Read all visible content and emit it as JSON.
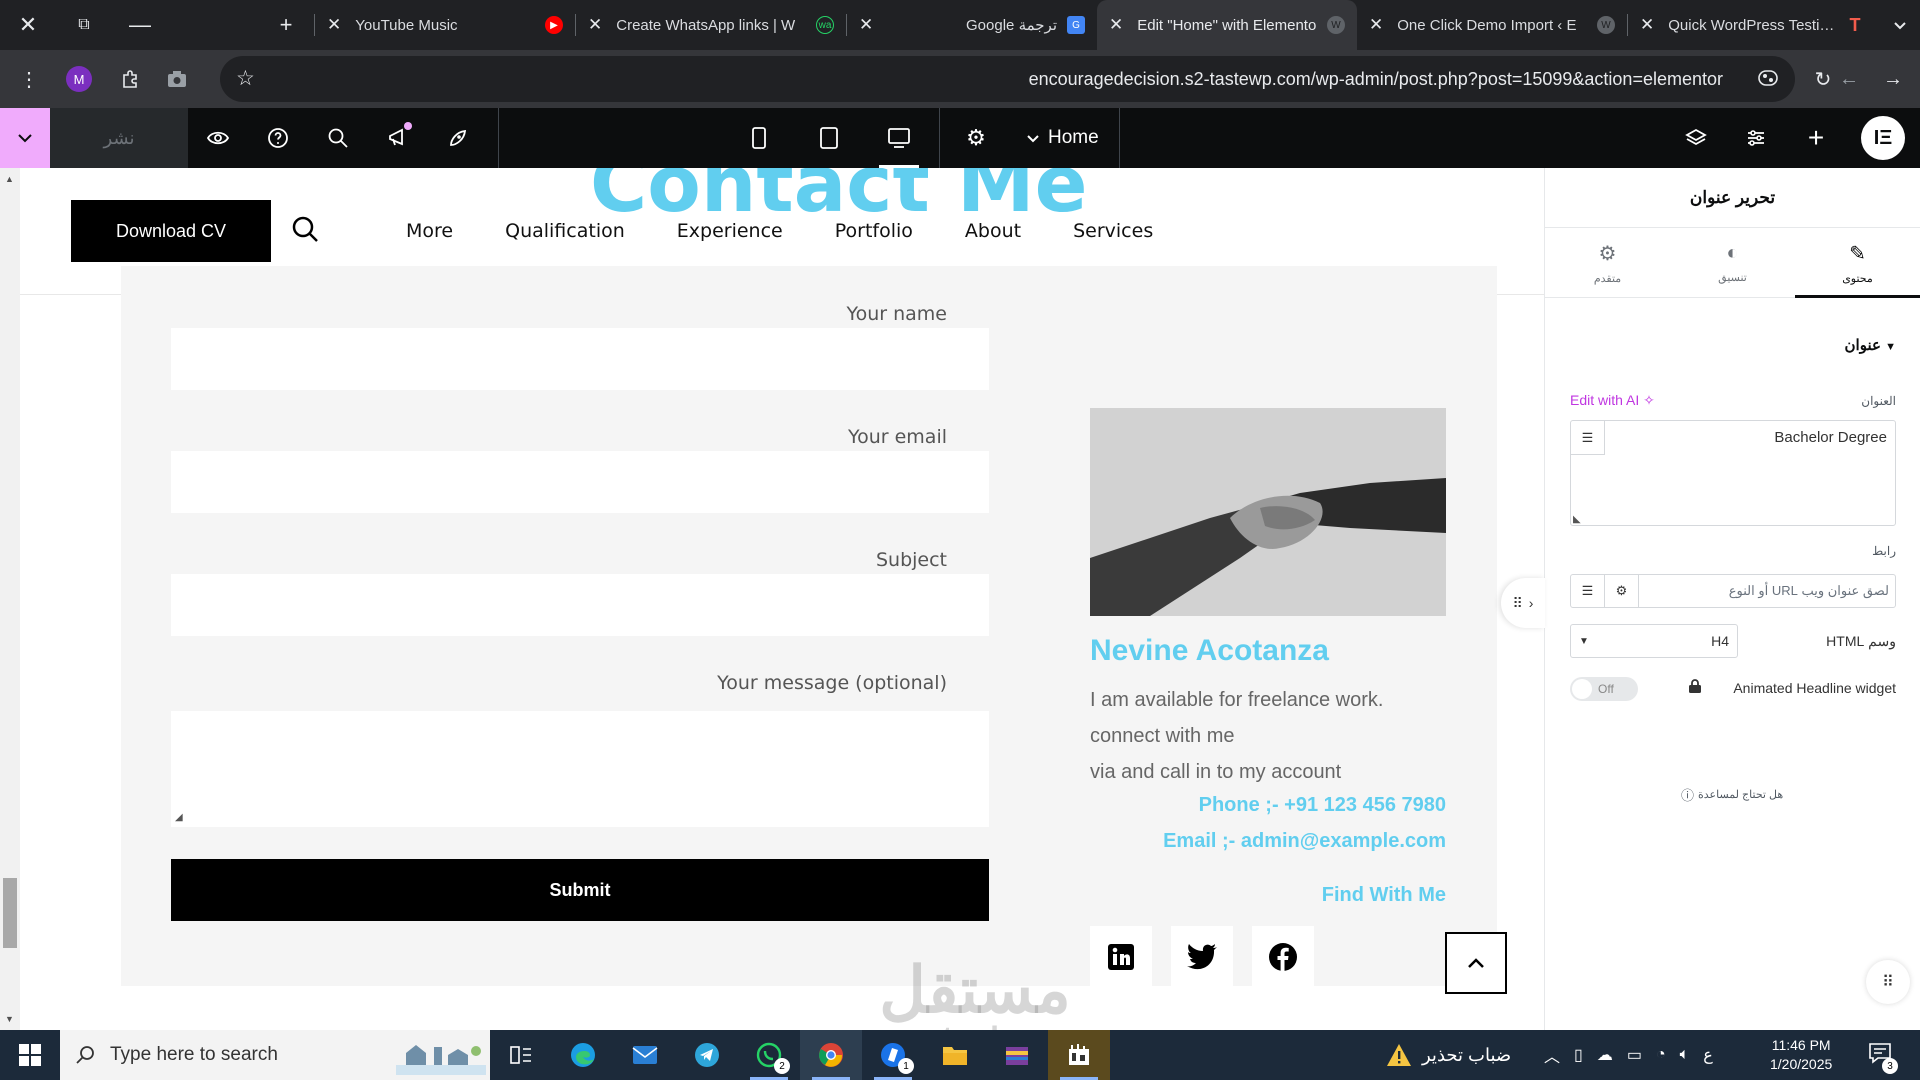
{
  "browser": {
    "tabs": [
      {
        "title": "YouTube Music",
        "icon": "youtube-music-icon"
      },
      {
        "title": "Create WhatsApp links | W",
        "icon": "whatsapp-icon"
      },
      {
        "title": "Google ترجمة",
        "icon": "google-translate-icon"
      },
      {
        "title": "Edit \"Home\" with Elemento",
        "icon": "wordpress-icon",
        "active": true
      },
      {
        "title": "One Click Demo Import ‹ E",
        "icon": "wordpress-icon"
      },
      {
        "title": "Quick WordPress Testing &",
        "icon": "tastewp-icon"
      }
    ],
    "profile_initial": "M",
    "url": "encouragedecision.s2-tastewp.com/wp-admin/post.php?post=15099&action=elementor"
  },
  "editor": {
    "publish_label": "نشر",
    "page_name": "Home",
    "panel": {
      "title": "تحرير عنوان",
      "tabs": [
        {
          "label": "محتوى",
          "icon": "pencil-icon",
          "active": true
        },
        {
          "label": "تنسيق",
          "icon": "contrast-icon"
        },
        {
          "label": "متقدم",
          "icon": "gear-icon"
        }
      ],
      "section_title": "عنوان",
      "title_field_label": "العنوان",
      "edit_ai_label": "Edit with AI",
      "title_value": "Bachelor Degree",
      "link_label": "رابط",
      "link_placeholder": "لصق عنوان ويب URL أو النوع",
      "html_tag_label": "وسم HTML",
      "html_tag_value": "H4",
      "toggle_label": "Off",
      "animated_label": "Animated Headline widget",
      "help_label": "هل تحتاج لمساعدة"
    }
  },
  "site": {
    "section_title": "Contact Me",
    "download_cv": "Download CV",
    "nav": [
      "More",
      "Qualification",
      "Experience",
      "Portfolio",
      "About",
      "Services"
    ],
    "form": {
      "name_label": "Your name",
      "email_label": "Your email",
      "subject_label": "Subject",
      "message_label": "Your message (optional)",
      "submit_label": "Submit"
    },
    "profile": {
      "name": "Nevine Acotanza",
      "lines": [
        "I am available for freelance work.",
        "connect with me",
        "via and call in to my account"
      ],
      "phone": "Phone ;- +91 123 456 7980",
      "email": "Email ;- admin@example.com",
      "find_label": "Find With Me",
      "socials": [
        "linkedin-icon",
        "twitter-icon",
        "facebook-icon"
      ]
    },
    "watermark": {
      "arabic": "مستقل",
      "latin": "mostaql.com"
    }
  },
  "taskbar": {
    "search_placeholder": "Type here to search",
    "whatsapp_badge": "2",
    "chrome_badge": "1",
    "weather_text": "ضباب تحذير",
    "lang": "ع",
    "time": "11:46 PM",
    "date": "1/20/2025",
    "notification_count": "3"
  },
  "colors": {
    "accent_blue": "#61ceef",
    "elementor_pink": "#f0abfc",
    "ai_purple": "#c036e1"
  }
}
